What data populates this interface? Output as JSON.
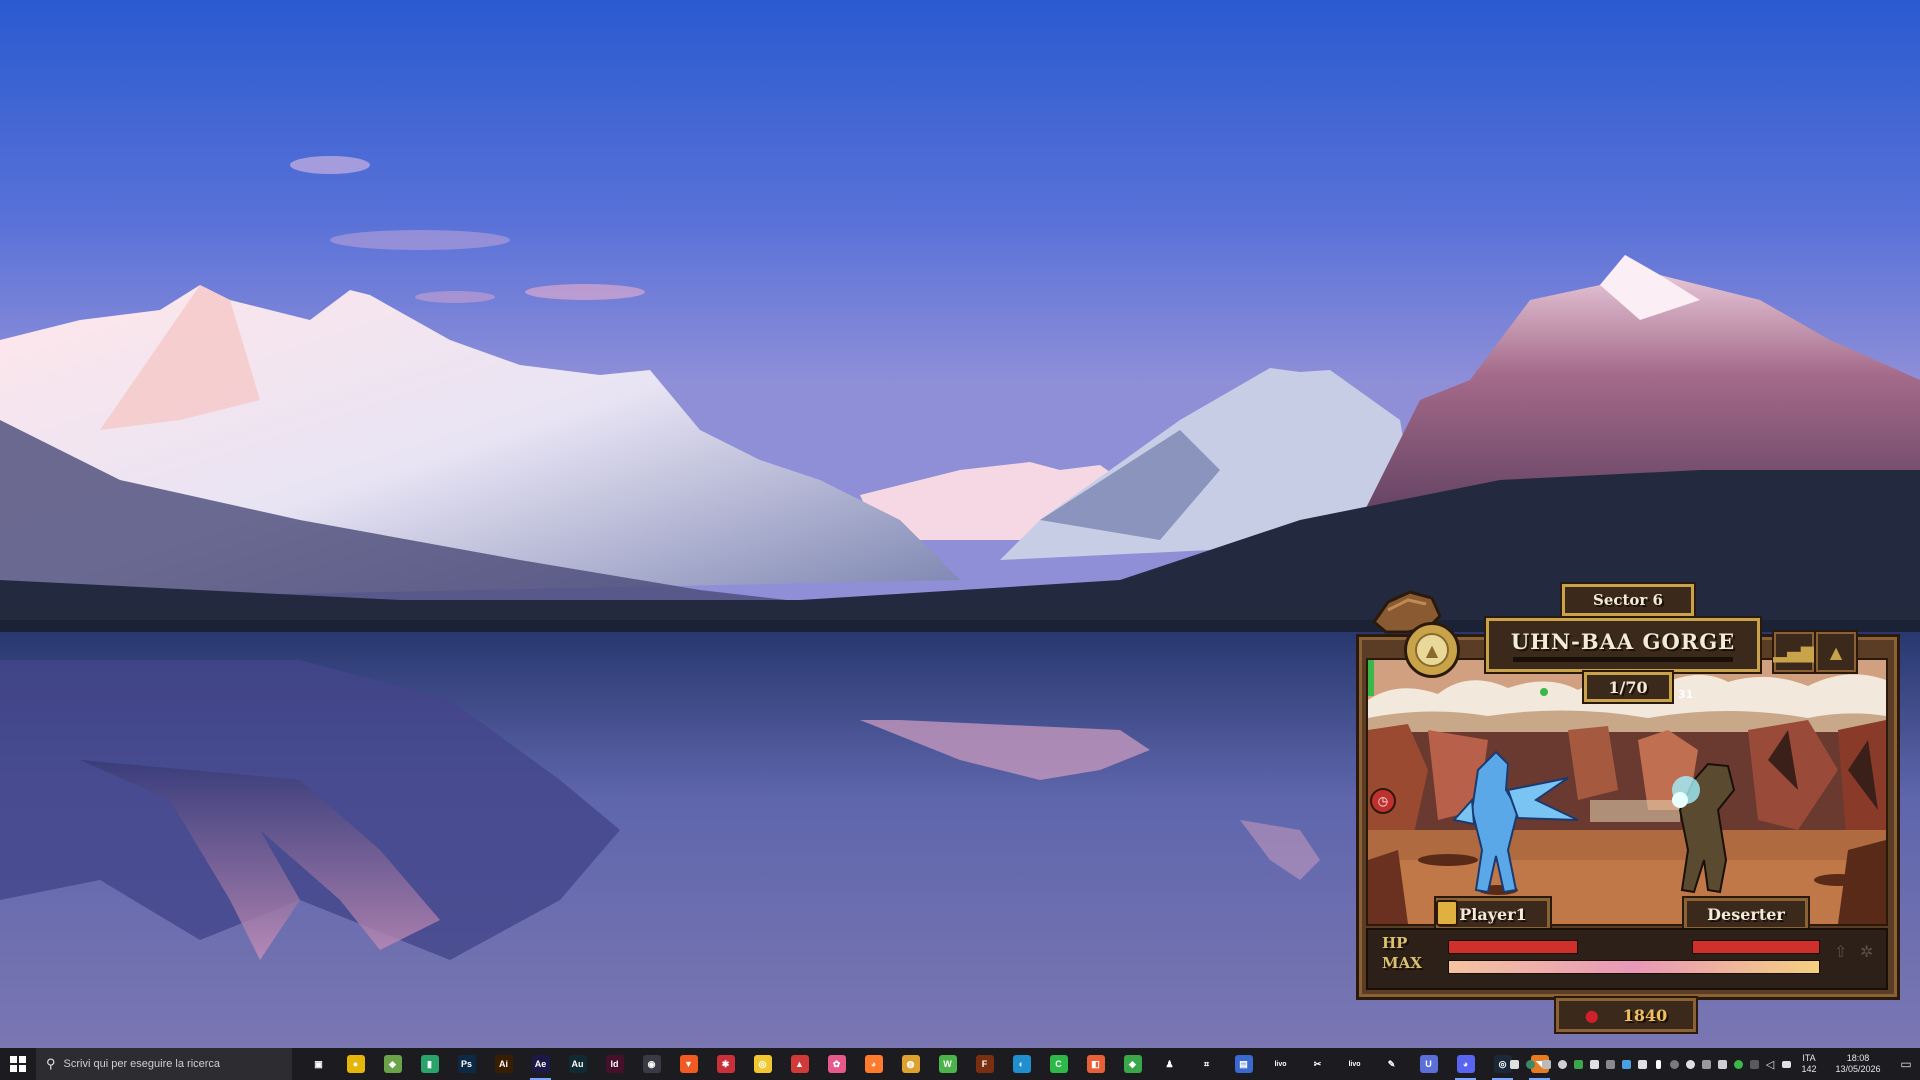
{
  "game": {
    "sector_label": "Sector 6",
    "location_name": "UHN-BAA GORGE",
    "wave_counter": "1/70",
    "damage_number": "31",
    "player_name": "Player1",
    "enemy_name": "Deserter",
    "hp_label": "HP",
    "max_label": "MAX",
    "currency": "1840",
    "player_hp_fraction": 1.0,
    "enemy_hp_fraction": 1.0,
    "max_fraction": 1.0,
    "colors": {
      "frame": "#5a3d24",
      "gold": "#c9a34a",
      "hp": "#d0302c",
      "text": "#f3ead8"
    }
  },
  "taskbar": {
    "search_placeholder": "Scrivi qui per eseguire la ricerca",
    "apps": [
      {
        "name": "task-view",
        "label": "",
        "color": "#1c1c20",
        "glyph": "▣"
      },
      {
        "name": "chrome-canary",
        "label": "",
        "color": "#e5b50a",
        "glyph": "●"
      },
      {
        "name": "app-folder",
        "label": "",
        "color": "#6ba34a",
        "glyph": "◆"
      },
      {
        "name": "audio-levels",
        "label": "",
        "color": "#2aa36b",
        "glyph": "▮"
      },
      {
        "name": "photoshop",
        "label": "Ps",
        "color": "#0c2a45",
        "glyph": "Ps"
      },
      {
        "name": "illustrator",
        "label": "Ai",
        "color": "#3a1c00",
        "glyph": "Ai"
      },
      {
        "name": "after-effects",
        "label": "Ae",
        "color": "#1c1847",
        "glyph": "Ae"
      },
      {
        "name": "audition",
        "label": "Au",
        "color": "#0f2a33",
        "glyph": "Au"
      },
      {
        "name": "indesign",
        "label": "Id",
        "color": "#45102c",
        "glyph": "Id"
      },
      {
        "name": "davinci",
        "label": "",
        "color": "#3a3a44",
        "glyph": "◉"
      },
      {
        "name": "brave",
        "label": "",
        "color": "#f25a24",
        "glyph": "▼"
      },
      {
        "name": "recorder",
        "label": "",
        "color": "#c9303a",
        "glyph": "✱"
      },
      {
        "name": "search-tool",
        "label": "",
        "color": "#f2c832",
        "glyph": "◎"
      },
      {
        "name": "affinity",
        "label": "",
        "color": "#d23a3a",
        "glyph": "▲"
      },
      {
        "name": "color-app",
        "label": "",
        "color": "#e55a8a",
        "glyph": "✿"
      },
      {
        "name": "firefox",
        "label": "",
        "color": "#ff7a2a",
        "glyph": "◕"
      },
      {
        "name": "chrome",
        "label": "",
        "color": "#e0a030",
        "glyph": "◍"
      },
      {
        "name": "webtoon",
        "label": "",
        "color": "#4bb34a",
        "glyph": "W"
      },
      {
        "name": "fl-app",
        "label": "",
        "color": "#7a3010",
        "glyph": "F"
      },
      {
        "name": "edge",
        "label": "",
        "color": "#1f8fd0",
        "glyph": "◐"
      },
      {
        "name": "camtasia",
        "label": "",
        "color": "#2fb84a",
        "glyph": "C"
      },
      {
        "name": "openshot",
        "label": "",
        "color": "#e8603a",
        "glyph": "◧"
      },
      {
        "name": "android",
        "label": "",
        "color": "#3aa84a",
        "glyph": "◆"
      },
      {
        "name": "app-figure",
        "label": "",
        "color": "#1c1c20",
        "glyph": "♟"
      },
      {
        "name": "crop-tool",
        "label": "",
        "color": "#1c1c20",
        "glyph": "⌗"
      },
      {
        "name": "window-app",
        "label": "",
        "color": "#3a6ad0",
        "glyph": "▤"
      },
      {
        "name": "livo-1",
        "label": "livo",
        "color": "#1c1c20",
        "glyph": "livo"
      },
      {
        "name": "capcut",
        "label": "",
        "color": "#1c1c20",
        "glyph": "✂"
      },
      {
        "name": "livo-2",
        "label": "livo",
        "color": "#1c1c20",
        "glyph": "livo"
      },
      {
        "name": "pen-app",
        "label": "",
        "color": "#1c1c20",
        "glyph": "✎"
      },
      {
        "name": "u-app",
        "label": "U",
        "color": "#5b6fd8",
        "glyph": "U"
      },
      {
        "name": "discord",
        "label": "",
        "color": "#5865f2",
        "glyph": "◕"
      },
      {
        "name": "steam",
        "label": "",
        "color": "#1b2838",
        "glyph": "◎"
      },
      {
        "name": "game-app",
        "label": "",
        "color": "#e87a20",
        "glyph": "◥"
      }
    ],
    "lang": "ITA",
    "lang_sub": "142",
    "time": "18:08",
    "date": "13/05/2026",
    "colors": {
      "bar": "#1c1c20",
      "search": "#2d2d31"
    }
  }
}
